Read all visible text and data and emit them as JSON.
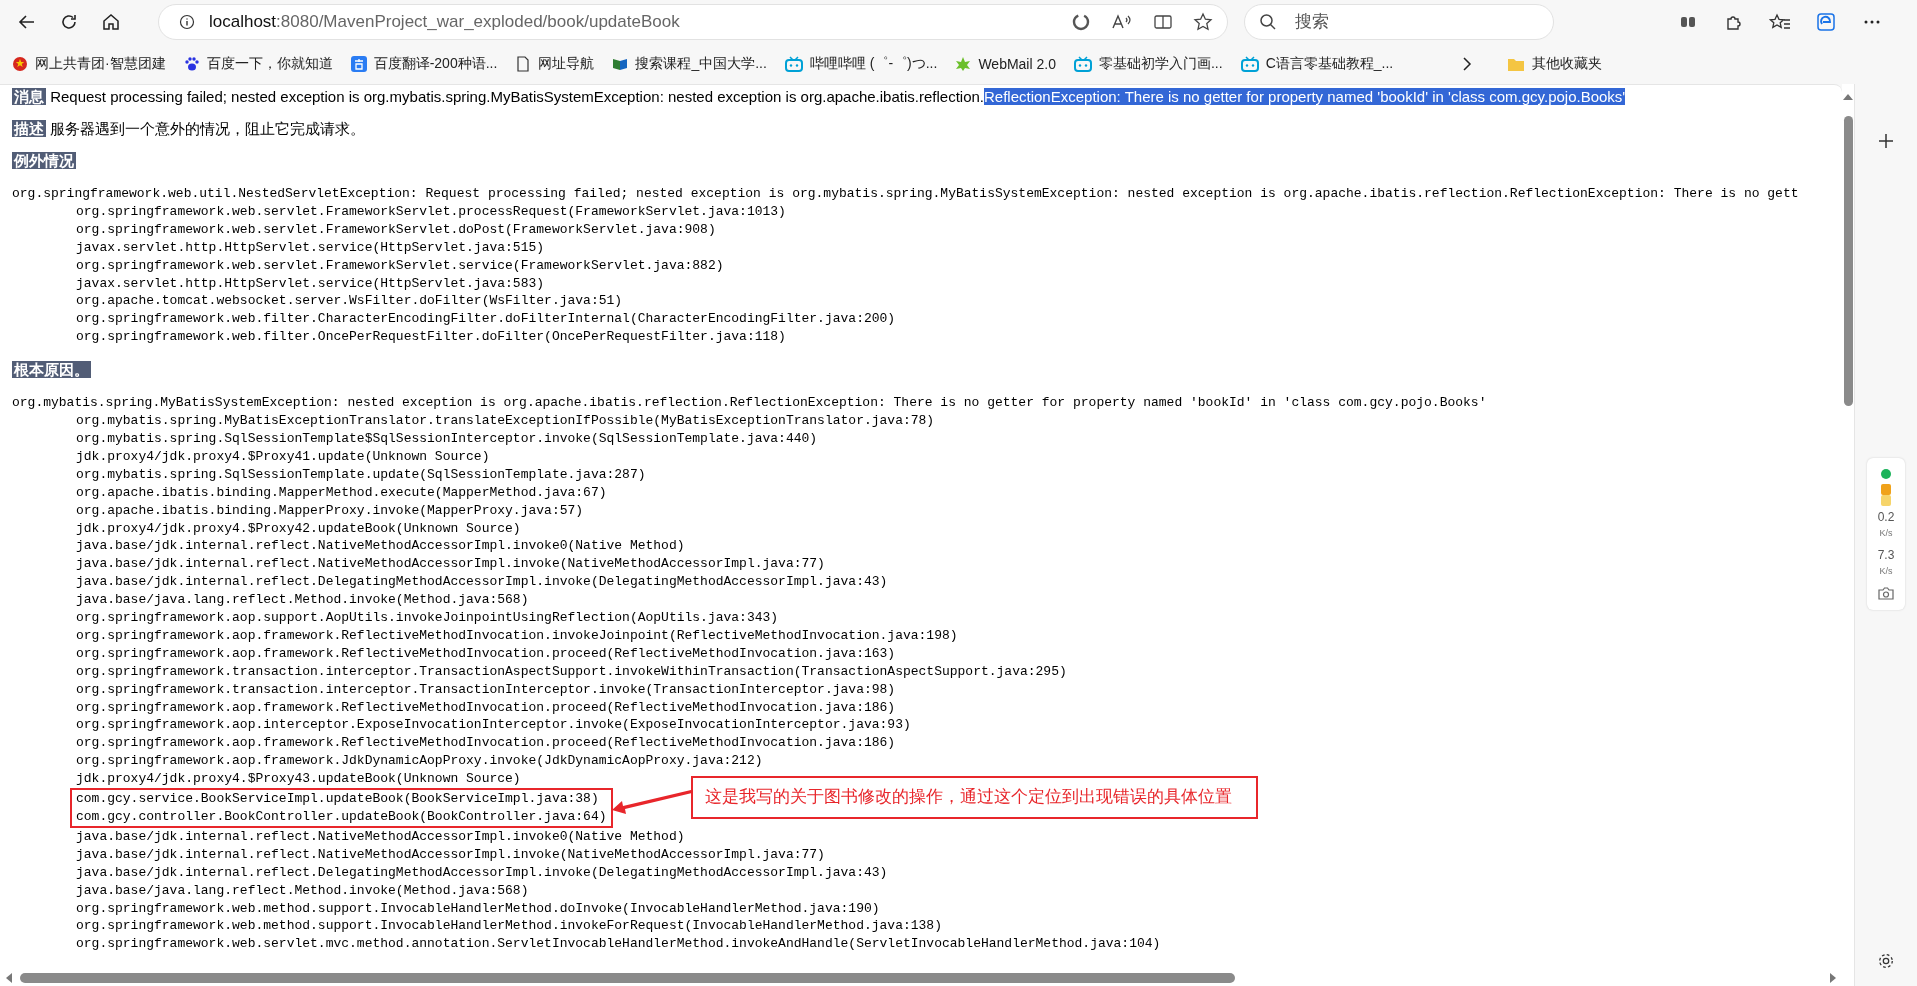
{
  "browser": {
    "address": {
      "host": "localhost",
      "path": ":8080/MavenProject_war_exploded/book/updateBook"
    },
    "search": {
      "placeholder": "搜索"
    }
  },
  "bookmarks": [
    {
      "label": "网上共青团·智慧团建",
      "kind": "emblem"
    },
    {
      "label": "百度一下，你就知道",
      "kind": "paw"
    },
    {
      "label": "百度翻译-200种语...",
      "kind": "translate"
    },
    {
      "label": "网址导航",
      "kind": "page"
    },
    {
      "label": "搜索课程_中国大学...",
      "kind": "book"
    },
    {
      "label": "哔哩哔哩 (゜-゜)つ...",
      "kind": "tv"
    },
    {
      "label": "WebMail 2.0",
      "kind": "leaf"
    },
    {
      "label": "零基础初学入门画...",
      "kind": "tv"
    },
    {
      "label": "C语言零基础教程_...",
      "kind": "tv"
    }
  ],
  "other_bookmarks": "其他收藏夹",
  "page": {
    "message": {
      "label": "消息",
      "segments": [
        {
          "text": "Request processing failed; nested exception is org.mybatis.spring.MyBatisSystemException: nested exception is org.apache.ibatis.reflection.",
          "selected": false
        },
        {
          "text": "ReflectionException: There is no getter for property named 'bookId' in 'class com.gcy.pojo.Books'",
          "selected": true
        }
      ]
    },
    "description": {
      "label": "描述",
      "text": "服务器遇到一个意外的情况，阻止它完成请求。"
    },
    "exception": {
      "heading": "例外情况",
      "head": "org.springframework.web.util.NestedServletException: Request processing failed; nested exception is org.mybatis.spring.MyBatisSystemException: nested exception is org.apache.ibatis.reflection.ReflectionException: There is no gett",
      "frames": [
        {
          "text": "org.springframework.web.servlet.FrameworkServlet.processRequest(FrameworkServlet.java:1013)",
          "marked": false
        },
        {
          "text": "org.springframework.web.servlet.FrameworkServlet.doPost(FrameworkServlet.java:908)",
          "marked": false
        },
        {
          "text": "javax.servlet.http.HttpServlet.service(HttpServlet.java:515)",
          "marked": false
        },
        {
          "text": "org.springframework.web.servlet.FrameworkServlet.service(FrameworkServlet.java:882)",
          "marked": false
        },
        {
          "text": "javax.servlet.http.HttpServlet.service(HttpServlet.java:583)",
          "marked": false
        },
        {
          "text": "org.apache.tomcat.websocket.server.WsFilter.doFilter(WsFilter.java:51)",
          "marked": false
        },
        {
          "text": "org.springframework.web.filter.CharacterEncodingFilter.doFilterInternal(CharacterEncodingFilter.java:200)",
          "marked": false
        },
        {
          "text": "org.springframework.web.filter.OncePerRequestFilter.doFilter(OncePerRequestFilter.java:118)",
          "marked": false
        }
      ]
    },
    "root_cause": {
      "heading": "根本原因。",
      "head": "org.mybatis.spring.MyBatisSystemException: nested exception is org.apache.ibatis.reflection.ReflectionException: There is no getter for property named 'bookId' in 'class com.gcy.pojo.Books'",
      "frames": [
        {
          "text": "org.mybatis.spring.MyBatisExceptionTranslator.translateExceptionIfPossible(MyBatisExceptionTranslator.java:78)",
          "marked": false
        },
        {
          "text": "org.mybatis.spring.SqlSessionTemplate$SqlSessionInterceptor.invoke(SqlSessionTemplate.java:440)",
          "marked": false
        },
        {
          "text": "jdk.proxy4/jdk.proxy4.$Proxy41.update(Unknown Source)",
          "marked": false
        },
        {
          "text": "org.mybatis.spring.SqlSessionTemplate.update(SqlSessionTemplate.java:287)",
          "marked": false
        },
        {
          "text": "org.apache.ibatis.binding.MapperMethod.execute(MapperMethod.java:67)",
          "marked": false
        },
        {
          "text": "org.apache.ibatis.binding.MapperProxy.invoke(MapperProxy.java:57)",
          "marked": false
        },
        {
          "text": "jdk.proxy4/jdk.proxy4.$Proxy42.updateBook(Unknown Source)",
          "marked": false
        },
        {
          "text": "java.base/jdk.internal.reflect.NativeMethodAccessorImpl.invoke0(Native Method)",
          "marked": false
        },
        {
          "text": "java.base/jdk.internal.reflect.NativeMethodAccessorImpl.invoke(NativeMethodAccessorImpl.java:77)",
          "marked": false
        },
        {
          "text": "java.base/jdk.internal.reflect.DelegatingMethodAccessorImpl.invoke(DelegatingMethodAccessorImpl.java:43)",
          "marked": false
        },
        {
          "text": "java.base/java.lang.reflect.Method.invoke(Method.java:568)",
          "marked": false
        },
        {
          "text": "org.springframework.aop.support.AopUtils.invokeJoinpointUsingReflection(AopUtils.java:343)",
          "marked": false
        },
        {
          "text": "org.springframework.aop.framework.ReflectiveMethodInvocation.invokeJoinpoint(ReflectiveMethodInvocation.java:198)",
          "marked": false
        },
        {
          "text": "org.springframework.aop.framework.ReflectiveMethodInvocation.proceed(ReflectiveMethodInvocation.java:163)",
          "marked": false
        },
        {
          "text": "org.springframework.transaction.interceptor.TransactionAspectSupport.invokeWithinTransaction(TransactionAspectSupport.java:295)",
          "marked": false
        },
        {
          "text": "org.springframework.transaction.interceptor.TransactionInterceptor.invoke(TransactionInterceptor.java:98)",
          "marked": false
        },
        {
          "text": "org.springframework.aop.framework.ReflectiveMethodInvocation.proceed(ReflectiveMethodInvocation.java:186)",
          "marked": false
        },
        {
          "text": "org.springframework.aop.interceptor.ExposeInvocationInterceptor.invoke(ExposeInvocationInterceptor.java:93)",
          "marked": false
        },
        {
          "text": "org.springframework.aop.framework.ReflectiveMethodInvocation.proceed(ReflectiveMethodInvocation.java:186)",
          "marked": false
        },
        {
          "text": "org.springframework.aop.framework.JdkDynamicAopProxy.invoke(JdkDynamicAopProxy.java:212)",
          "marked": false
        },
        {
          "text": "jdk.proxy4/jdk.proxy4.$Proxy43.updateBook(Unknown Source)",
          "marked": false
        },
        {
          "text": "com.gcy.service.BookServiceImpl.updateBook(BookServiceImpl.java:38)",
          "marked": true
        },
        {
          "text": "com.gcy.controller.BookController.updateBook(BookController.java:64)",
          "marked": true
        },
        {
          "text": "java.base/jdk.internal.reflect.NativeMethodAccessorImpl.invoke0(Native Method)",
          "marked": false
        },
        {
          "text": "java.base/jdk.internal.reflect.NativeMethodAccessorImpl.invoke(NativeMethodAccessorImpl.java:77)",
          "marked": false
        },
        {
          "text": "java.base/jdk.internal.reflect.DelegatingMethodAccessorImpl.invoke(DelegatingMethodAccessorImpl.java:43)",
          "marked": false
        },
        {
          "text": "java.base/java.lang.reflect.Method.invoke(Method.java:568)",
          "marked": false
        },
        {
          "text": "org.springframework.web.method.support.InvocableHandlerMethod.doInvoke(InvocableHandlerMethod.java:190)",
          "marked": false
        },
        {
          "text": "org.springframework.web.method.support.InvocableHandlerMethod.invokeForRequest(InvocableHandlerMethod.java:138)",
          "marked": false
        },
        {
          "text": "org.springframework.web.servlet.mvc.method.annotation.ServletInvocableHandlerMethod.invokeAndHandle(ServletInvocableHandlerMethod.java:104)",
          "marked": false
        }
      ]
    }
  },
  "annotation": {
    "text": "这是我写的关于图书修改的操作，通过这个定位到出现错误的具体位置"
  },
  "network_widget": {
    "upload": "0.2",
    "upload_unit": "K/s",
    "download": "7.3",
    "download_unit": "K/s"
  }
}
